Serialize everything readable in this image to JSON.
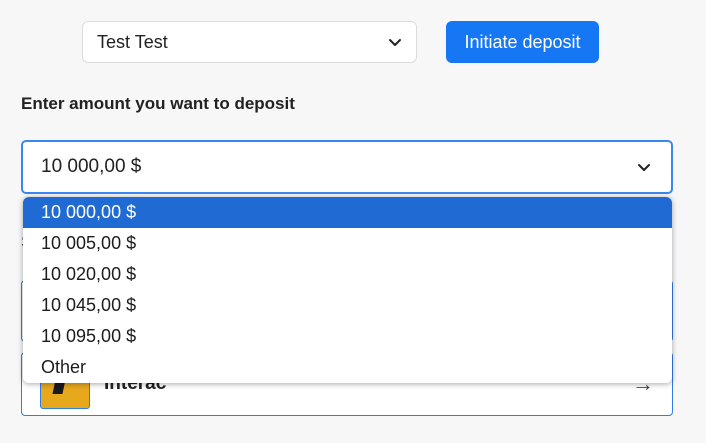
{
  "account": {
    "value": "Test Test"
  },
  "initiate_button": {
    "label": "Initiate deposit"
  },
  "amount": {
    "label": "Enter amount you want to deposit",
    "selected": "10 000,00 $",
    "options": [
      "10 000,00 $",
      "10 005,00 $",
      "10 020,00 $",
      "10 045,00 $",
      "10 095,00 $",
      "Other"
    ]
  },
  "payment_method": {
    "hint_letter": "S",
    "interac_label": "Interac",
    "arrow": "→"
  },
  "colors": {
    "accent": "#1677f5",
    "selected_option": "#1f6bd3",
    "interac_brand": "#e7a81c"
  }
}
